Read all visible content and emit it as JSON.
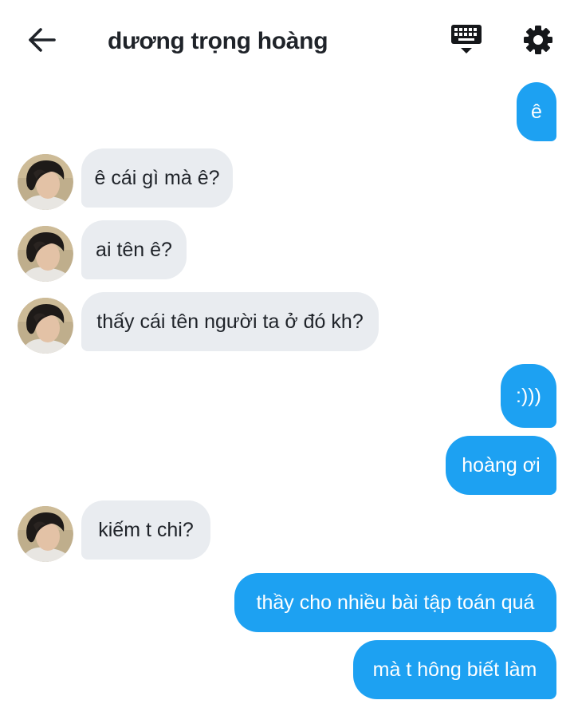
{
  "header": {
    "contact_name": "dương trọng hoàng",
    "back_icon": "arrow-left-icon",
    "keyboard_icon": "keyboard-icon",
    "settings_icon": "gear-icon"
  },
  "messages": [
    {
      "from": "me",
      "text": "ê"
    },
    {
      "from": "contact",
      "text": "ê cái gì mà ê?"
    },
    {
      "from": "contact",
      "text": "ai tên ê?"
    },
    {
      "from": "contact",
      "text": "thấy cái tên người ta ở đó kh?"
    },
    {
      "from": "me",
      "text": ":)))"
    },
    {
      "from": "me",
      "text": "hoàng ơi"
    },
    {
      "from": "contact",
      "text": "kiếm t chi?"
    },
    {
      "from": "me",
      "text": "thầy cho nhiều bài tập toán quá"
    },
    {
      "from": "me",
      "text": "mà t hông biết làm"
    }
  ],
  "colors": {
    "outgoing_bubble": "#1da1f2",
    "incoming_bubble": "#e9ecf0",
    "text": "#1f2329"
  }
}
